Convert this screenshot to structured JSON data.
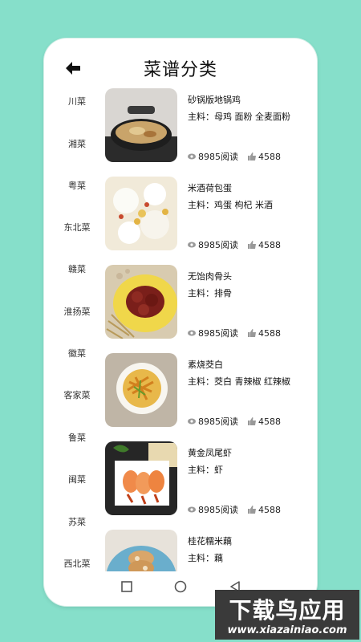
{
  "header": {
    "title": "菜谱分类",
    "back_icon": "arrow-left-icon"
  },
  "sidebar": {
    "items": [
      {
        "label": "川菜"
      },
      {
        "label": "湘菜"
      },
      {
        "label": "粤菜"
      },
      {
        "label": "东北菜"
      },
      {
        "label": "赣菜"
      },
      {
        "label": "淮扬菜"
      },
      {
        "label": "徽菜"
      },
      {
        "label": "客家菜"
      },
      {
        "label": "鲁菜"
      },
      {
        "label": "闽菜"
      },
      {
        "label": "苏菜"
      },
      {
        "label": "西北菜"
      }
    ]
  },
  "recipes": [
    {
      "name": "砂锅版地锅鸡",
      "ingredients": "主料：母鸡 面粉 全麦面粉",
      "views": "8985阅读",
      "likes": "4588"
    },
    {
      "name": "米酒荷包蛋",
      "ingredients": "主料：鸡蛋 枸杞 米酒",
      "views": "8985阅读",
      "likes": "4588"
    },
    {
      "name": "无饴肉骨头",
      "ingredients": "主料：排骨",
      "views": "8985阅读",
      "likes": "4588"
    },
    {
      "name": "素烧茭白",
      "ingredients": "主料：茭白 青辣椒 红辣椒",
      "views": "8985阅读",
      "likes": "4588"
    },
    {
      "name": "黄金凤尾虾",
      "ingredients": "主料：虾",
      "views": "8985阅读",
      "likes": "4588"
    },
    {
      "name": "桂花糯米藕",
      "ingredients": "主料：藕",
      "views": "",
      "likes": ""
    }
  ],
  "navbar": {
    "square_icon": "recent-apps-square-icon",
    "circle_icon": "home-circle-icon",
    "triangle_icon": "back-triangle-icon"
  },
  "watermark": {
    "title": "下载鸟应用",
    "url": "www.xiazainiao.com"
  },
  "colors": {
    "background": "#86dfca",
    "card": "#ffffff",
    "text": "#111111",
    "watermark_bg": "#3a3a3a"
  }
}
